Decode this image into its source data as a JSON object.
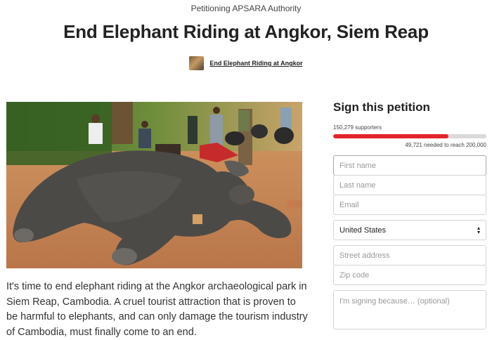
{
  "header": {
    "targeting": "Petitioning APSARA Authority",
    "title": "End Elephant Riding at Angkor, Siem Reap",
    "starter_link": "End Elephant Riding at Angkor"
  },
  "body": {
    "text": "It's time to end elephant riding at the Angkor archaeological park in Siem Reap, Cambodia. A cruel tourist attraction that is proven to be harmful to elephants, and can only damage the tourism industry of Cambodia, must finally come to an end."
  },
  "sign": {
    "title": "Sign this petition",
    "supporters": "150,279 supporters",
    "needed": "49,721 needed to reach 200,000",
    "progress_fraction": 0.7514,
    "progress_color": "#e3242b",
    "fields": {
      "first_name": "First name",
      "last_name": "Last name",
      "email": "Email",
      "country": "United States",
      "street": "Street address",
      "zip": "Zip code",
      "reason": "I'm signing because… (optional)"
    }
  }
}
